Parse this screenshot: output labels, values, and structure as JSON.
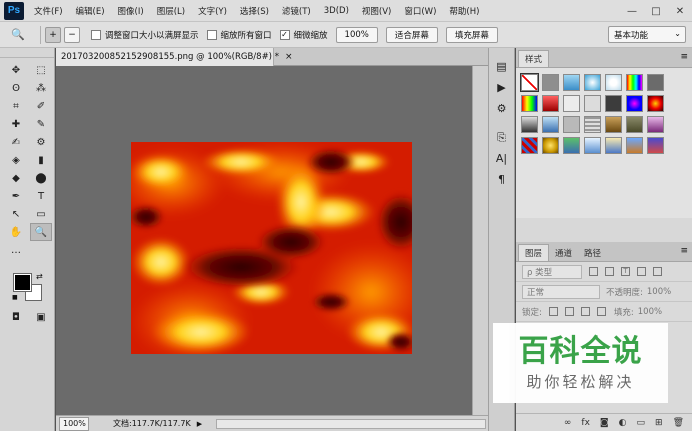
{
  "app": {
    "logo_text": "Ps",
    "menu": [
      "文件(F)",
      "编辑(E)",
      "图像(I)",
      "图层(L)",
      "文字(Y)",
      "选择(S)",
      "滤镜(T)",
      "3D(D)",
      "视图(V)",
      "窗口(W)",
      "帮助(H)"
    ],
    "window_controls": [
      "—",
      "□",
      "✕"
    ]
  },
  "options_bar": {
    "tool_icon": "🔍",
    "zoom_in_icon": "+",
    "zoom_out_icon": "−",
    "resize_windows_label": "调整窗口大小以满屏显示",
    "resize_windows_checked": false,
    "zoom_all_windows_label": "缩放所有窗口",
    "zoom_all_windows_checked": false,
    "scrubby_zoom_label": "细微缩放",
    "scrubby_zoom_checked": true,
    "percent_button": "100%",
    "fit_screen_button": "适合屏幕",
    "fill_screen_button": "填充屏幕",
    "workspace": "基本功能"
  },
  "document": {
    "tab_title": "20170320085215290815​5.png @ 100%(RGB/8#) *",
    "tab_close": "×",
    "zoom": "100%",
    "doc_info": "文档:117.7K/117.7K",
    "status_arrow": "▶"
  },
  "tools": {
    "items": [
      "✥",
      "⬚",
      "ʘ",
      "⁂",
      "⌗",
      "✐",
      "✚",
      "✎",
      "✍",
      "⚙",
      "◈",
      "▮",
      "◆",
      "⬤",
      "✒",
      "T",
      "↖",
      "▭",
      "✋",
      "🔍",
      "…",
      ""
    ],
    "swap_icon": "⇄",
    "default_icon": "■",
    "quickmask_icon": "◘",
    "screenmode_icon": "▣"
  },
  "icon_strip": [
    "▤",
    "▶",
    "⚙",
    "⎘",
    "A|",
    "¶"
  ],
  "styles_panel": {
    "tab": "样式",
    "menu_icon": "≡",
    "footer_icons": [
      "⊘",
      "⊞",
      "🗑"
    ]
  },
  "layers_panel": {
    "tabs": [
      "图层",
      "通道",
      "路径"
    ],
    "menu_icon": "≡",
    "filter_label": "ρ 类型",
    "blend_mode": "正常",
    "opacity_label": "不透明度:",
    "opacity_value": "100%",
    "lock_label": "锁定:",
    "fill_label": "填充:",
    "fill_value": "100%",
    "footer_icons": [
      "∞",
      "fx",
      "◙",
      "◐",
      "▭",
      "⊞",
      "🗑"
    ]
  },
  "watermark": {
    "title": "百科全说",
    "subtitle": "助你轻松解决"
  },
  "colors": {
    "menu_bg": "#dedede",
    "canvas_bg": "#6b6b6b",
    "watermark_green": "#35a245",
    "fire_dark": "#2a0300",
    "fire_red": "#d41c00",
    "fire_orange": "#ff7a00",
    "fire_yellow": "#ffd21a"
  }
}
